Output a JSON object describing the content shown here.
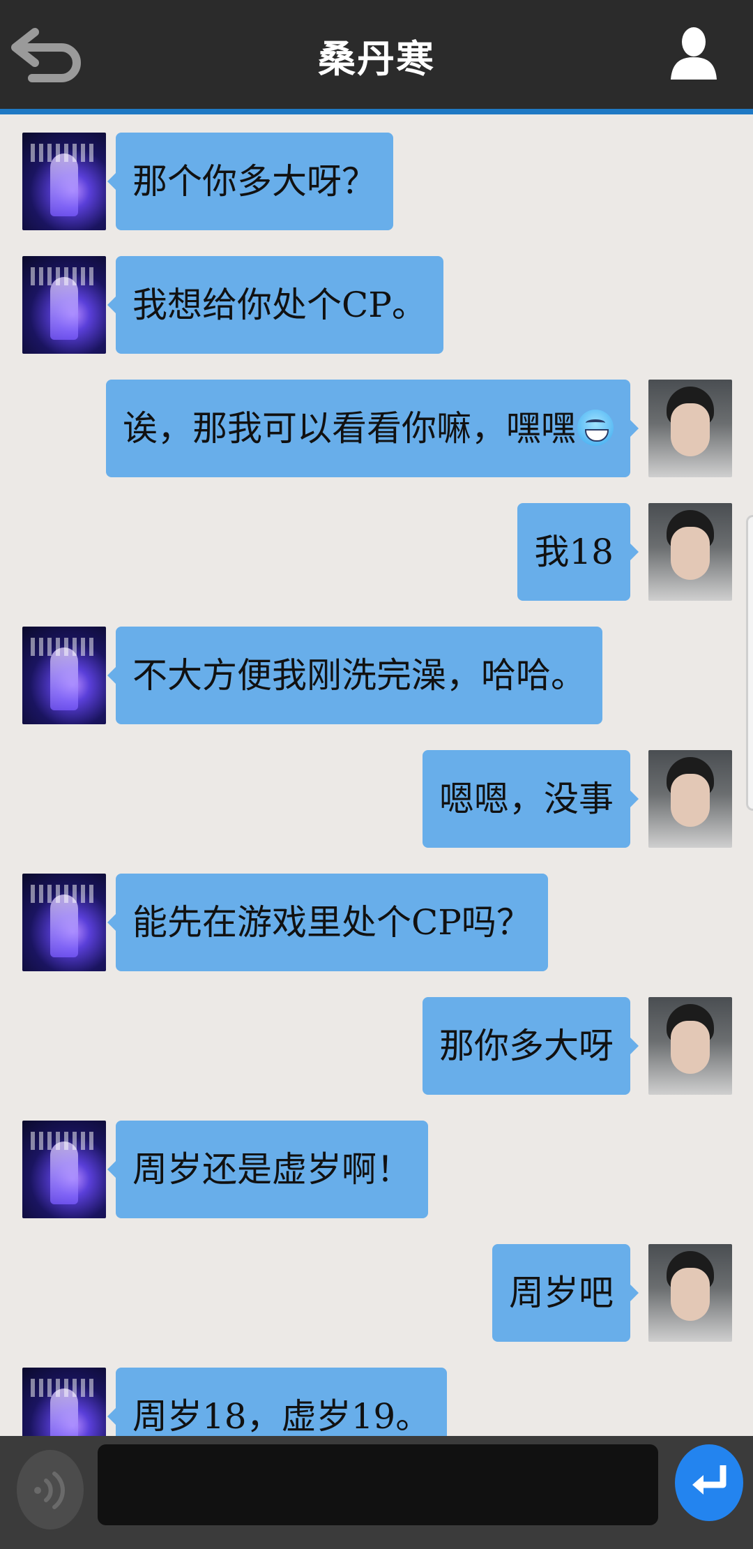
{
  "header": {
    "title": "桑丹寒",
    "back_icon": "back-arrow-icon",
    "profile_icon": "person-icon"
  },
  "colors": {
    "header_bg": "#2b2b2b",
    "header_accent": "#1f79c4",
    "chat_bg": "#ece9e6",
    "bubble": "#68aeea",
    "bottom_bar": "#3b3b3b",
    "send_button": "#2384ef"
  },
  "messages": [
    {
      "from": "other",
      "text": "那个你多大呀？"
    },
    {
      "from": "other",
      "text": "我想给你处个CP。"
    },
    {
      "from": "me",
      "text": "诶，那我可以看看你嘛，嘿嘿",
      "emoji": "grin-emoji-icon"
    },
    {
      "from": "me",
      "text": "我18"
    },
    {
      "from": "other",
      "text": "不大方便我刚洗完澡，哈哈。"
    },
    {
      "from": "me",
      "text": "嗯嗯，没事"
    },
    {
      "from": "other",
      "text": "能先在游戏里处个CP吗？"
    },
    {
      "from": "me",
      "text": "那你多大呀"
    },
    {
      "from": "other",
      "text": "周岁还是虚岁啊！"
    },
    {
      "from": "me",
      "text": "周岁吧"
    },
    {
      "from": "other",
      "text": "周岁18，虚岁19。"
    }
  ],
  "input": {
    "value": "",
    "placeholder": "",
    "voice_icon": "voice-wave-icon",
    "send_icon": "enter-arrow-icon"
  }
}
